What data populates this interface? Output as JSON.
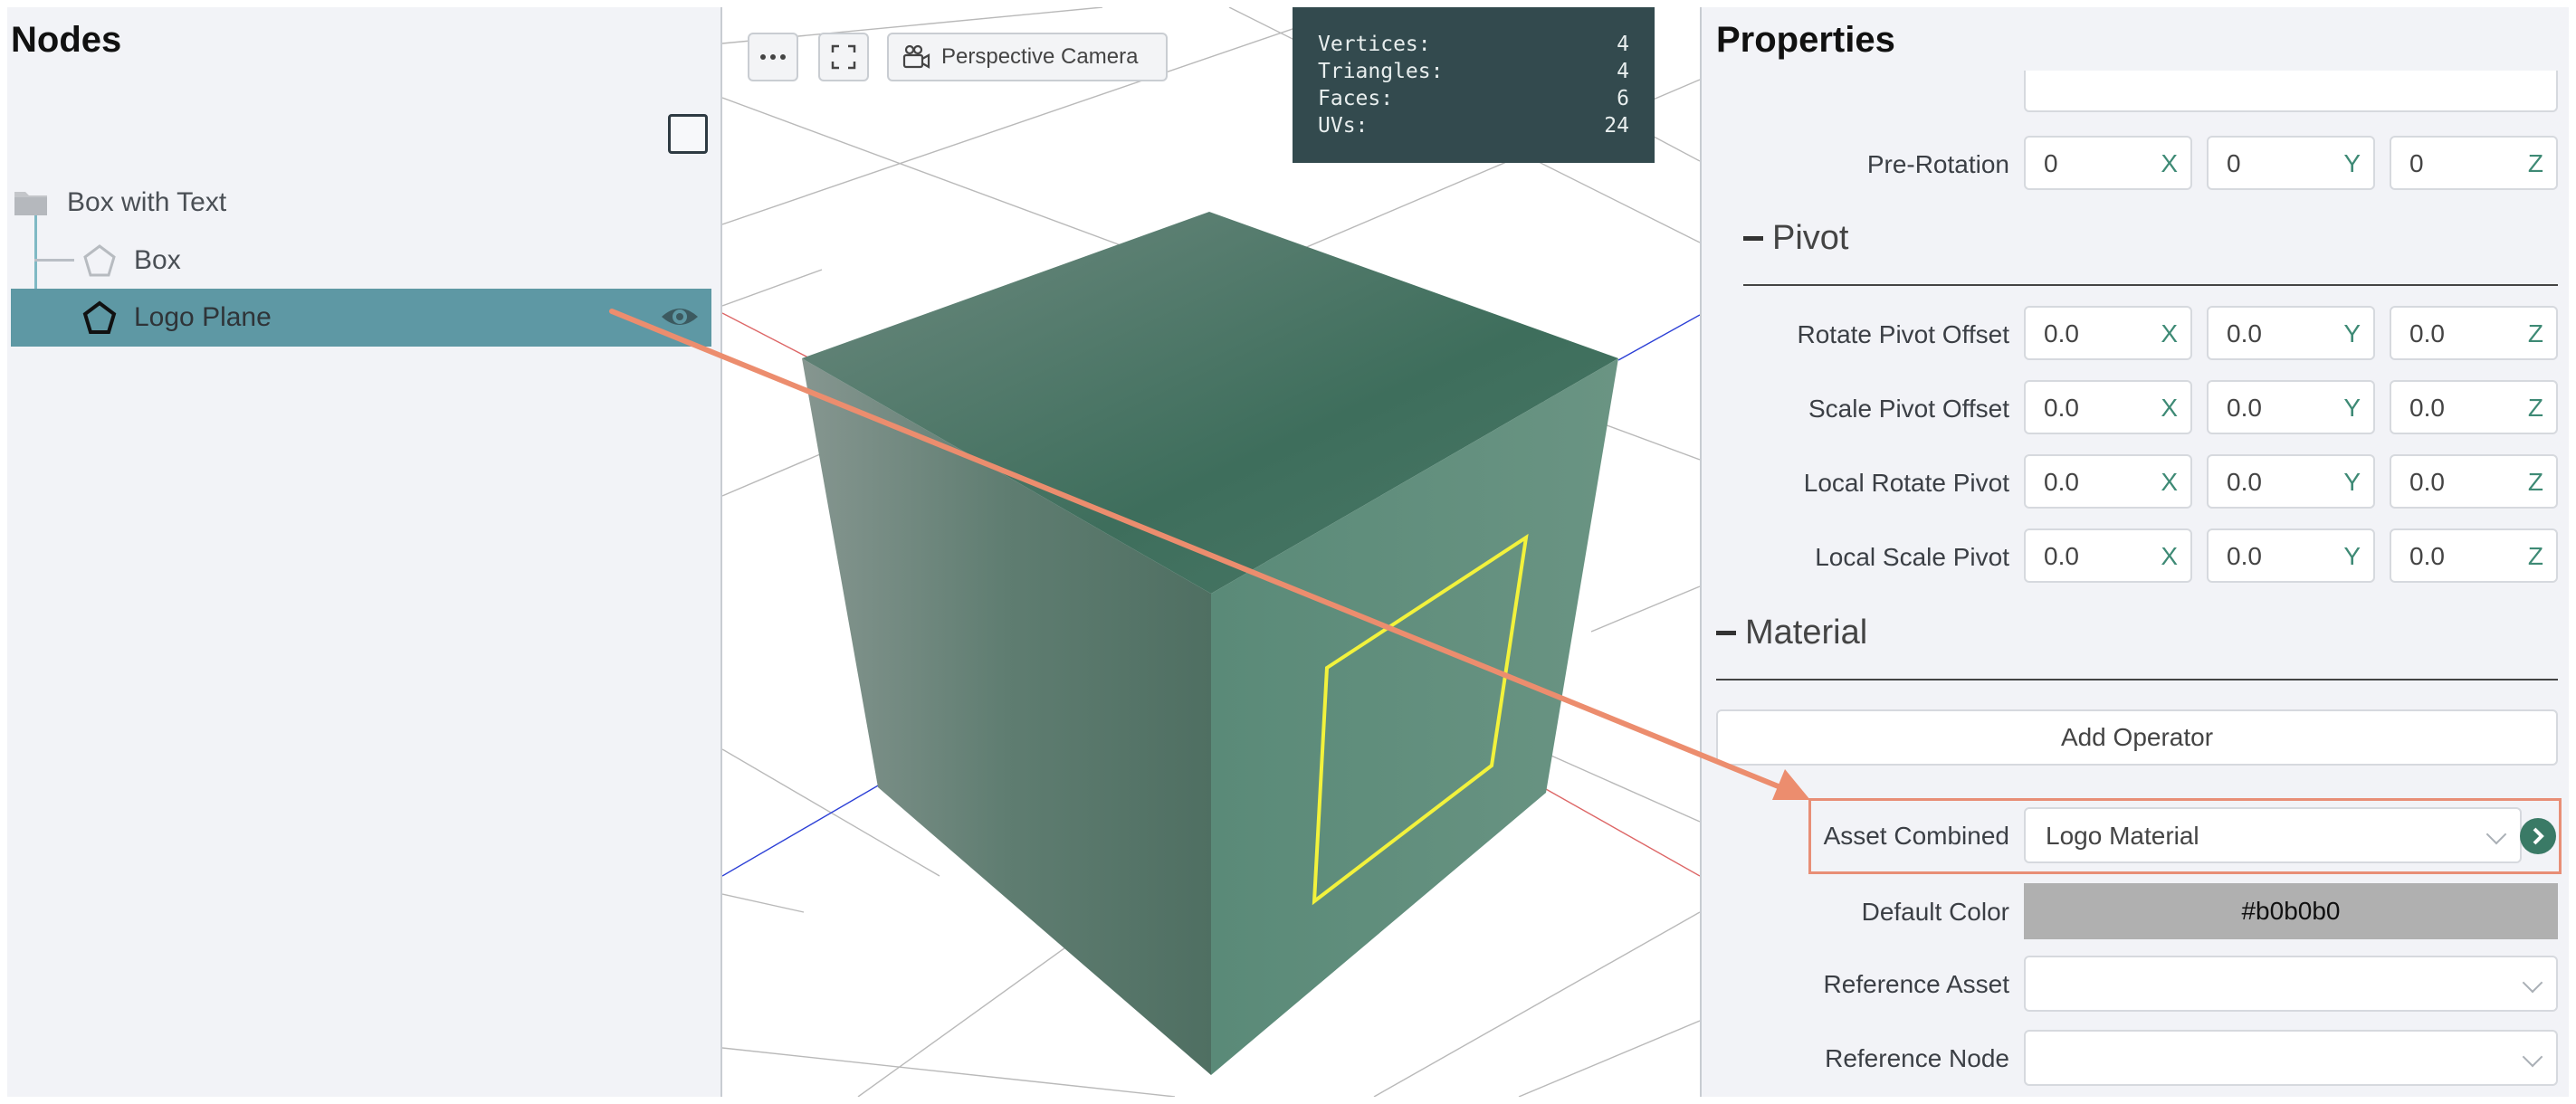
{
  "nodes": {
    "title": "Nodes",
    "items": [
      {
        "label": "Box with Text",
        "icon": "folder-icon"
      },
      {
        "label": "Box",
        "icon": "pentagon-icon"
      },
      {
        "label": "Logo Plane",
        "icon": "pentagon-icon",
        "selected": true
      }
    ]
  },
  "viewport": {
    "camera_label": "Perspective Camera",
    "stats": [
      {
        "label": "Vertices:",
        "value": "4"
      },
      {
        "label": "Triangles:",
        "value": "4"
      },
      {
        "label": "Faces:",
        "value": "6"
      },
      {
        "label": "UVs:",
        "value": "24"
      }
    ]
  },
  "properties": {
    "title": "Properties",
    "pre_rotation": {
      "label": "Pre-Rotation",
      "x": "0",
      "y": "0",
      "z": "0"
    },
    "pivot": {
      "header": "Pivot",
      "rows": [
        {
          "label": "Rotate Pivot Offset",
          "x": "0.0",
          "y": "0.0",
          "z": "0.0"
        },
        {
          "label": "Scale Pivot Offset",
          "x": "0.0",
          "y": "0.0",
          "z": "0.0"
        },
        {
          "label": "Local Rotate Pivot",
          "x": "0.0",
          "y": "0.0",
          "z": "0.0"
        },
        {
          "label": "Local Scale Pivot",
          "x": "0.0",
          "y": "0.0",
          "z": "0.0"
        }
      ]
    },
    "axis_labels": {
      "x": "X",
      "y": "Y",
      "z": "Z"
    },
    "material": {
      "header": "Material",
      "add_operator_label": "Add Operator",
      "asset_combined_label": "Asset Combined",
      "asset_combined_value": "Logo Material",
      "default_color_label": "Default Color",
      "default_color_value": "#b0b0b0",
      "reference_asset_label": "Reference Asset",
      "reference_asset_value": "",
      "reference_node_label": "Reference Node",
      "reference_node_value": ""
    }
  },
  "colors": {
    "selection": "#5e98a4",
    "accent": "#3e8a75",
    "highlight": "#e88e76",
    "uv_outline": "#f2f23c"
  }
}
